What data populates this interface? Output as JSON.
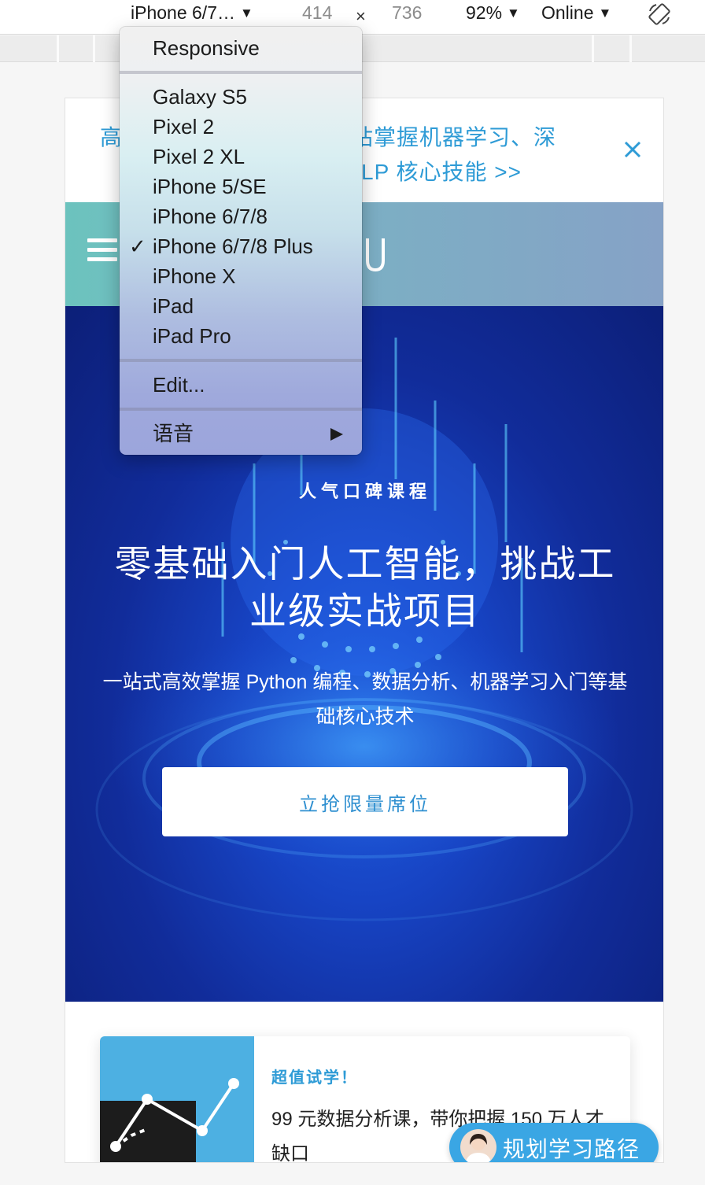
{
  "toolbar": {
    "device_label": "iPhone 6/7…",
    "width": "414",
    "times": "×",
    "height": "736",
    "zoom": "92%",
    "throttle": "Online"
  },
  "device_menu": {
    "responsive": "Responsive",
    "devices": [
      "Galaxy S5",
      "Pixel 2",
      "Pixel 2 XL",
      "iPhone 5/SE",
      "iPhone 6/7/8",
      "iPhone 6/7/8 Plus",
      "iPhone X",
      "iPad",
      "iPad Pro"
    ],
    "selected_device": "iPhone 6/7/8 Plus",
    "check_mark": "✓",
    "edit": "Edit...",
    "language": "语音"
  },
  "page": {
    "promo": {
      "line1": "高　　　　　　　术，一站掌握机器学习、深",
      "line2": "LP 核心技能 >>"
    },
    "hero": {
      "kicker": "人气口碑课程",
      "title": "零基础入门人工智能，挑战工业级实战项目",
      "subtitle": "一站式高效掌握 Python 编程、数据分析、机器学习入门等基础核心技术",
      "cta": "立抢限量席位"
    },
    "card": {
      "tag": "超值试学！",
      "text": "99 元数据分析课，带你把握 150 万人才缺口"
    },
    "chat": {
      "label": "规划学习路径"
    }
  },
  "colors": {
    "accent": "#2e9bd6",
    "hero_dark": "#0c1f78",
    "hero_light": "#1f5fe0",
    "header_teal": "#6cc3be"
  },
  "icons": {
    "caret": "caret-down-icon",
    "rotate": "rotate-device-icon",
    "close": "close-icon",
    "menu": "hamburger-menu-icon",
    "logo": "udacity-logo-icon",
    "submenu": "submenu-arrow-icon"
  }
}
